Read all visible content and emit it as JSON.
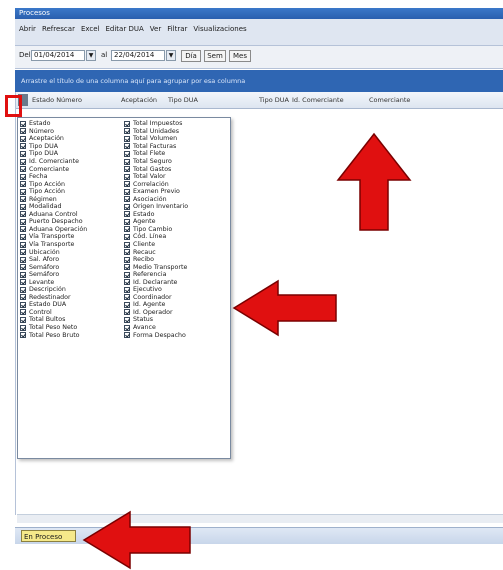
{
  "window": {
    "title": "Procesos"
  },
  "menu": [
    "Abrir",
    "Refrescar",
    "Excel",
    "Editar DUA",
    "Ver",
    "Filtrar",
    "Visualizaciones"
  ],
  "toolbar": {
    "from_label": "Del",
    "from_value": "01/04/2014",
    "to_label": "al",
    "to_value": "22/04/2014",
    "btn_day": "Día",
    "btn_week": "Sem",
    "btn_month": "Mes"
  },
  "group_bar": {
    "text": "Arrastre el título de una columna aquí para agrupar por esa columna"
  },
  "grid_headers": [
    "Estado Número",
    "Aceptación",
    "Tipo DUA",
    "Tipo DUA",
    "Id. Comerciante",
    "Comerciante"
  ],
  "column_chooser": {
    "left": [
      {
        "label": "Estado",
        "checked": true
      },
      {
        "label": "Número",
        "checked": true
      },
      {
        "label": "Aceptación",
        "checked": true
      },
      {
        "label": "Tipo DUA",
        "checked": true
      },
      {
        "label": "Tipo DUA",
        "checked": true
      },
      {
        "label": "Id. Comerciante",
        "checked": true
      },
      {
        "label": "Comerciante",
        "checked": true
      },
      {
        "label": "Fecha",
        "checked": true
      },
      {
        "label": "Tipo Acción",
        "checked": true
      },
      {
        "label": "Tipo Acción",
        "checked": true
      },
      {
        "label": "Régimen",
        "checked": true
      },
      {
        "label": "Modalidad",
        "checked": true
      },
      {
        "label": "Aduana Control",
        "checked": true
      },
      {
        "label": "Puerto Despacho",
        "checked": true
      },
      {
        "label": "Aduana Operación",
        "checked": true
      },
      {
        "label": "Vía Transporte",
        "checked": true
      },
      {
        "label": "Vía Transporte",
        "checked": true
      },
      {
        "label": "Ubicación",
        "checked": true
      },
      {
        "label": "Sal. Aforo",
        "checked": true
      },
      {
        "label": "Semáforo",
        "checked": true
      },
      {
        "label": "Semáforo",
        "checked": true
      },
      {
        "label": "Levante",
        "checked": true
      },
      {
        "label": "Descripción",
        "checked": true
      },
      {
        "label": "Redestinador",
        "checked": true
      },
      {
        "label": "Estado DUA",
        "checked": true
      },
      {
        "label": "Control",
        "checked": true
      },
      {
        "label": "Total Bultos",
        "checked": true
      },
      {
        "label": "Total Peso Neto",
        "checked": true
      },
      {
        "label": "Total Peso Bruto",
        "checked": true
      }
    ],
    "right": [
      {
        "label": "Total Impuestos",
        "checked": true
      },
      {
        "label": "Total Unidades",
        "checked": true
      },
      {
        "label": "Total Volumen",
        "checked": true
      },
      {
        "label": "Total Facturas",
        "checked": true
      },
      {
        "label": "Total Flete",
        "checked": true
      },
      {
        "label": "Total Seguro",
        "checked": true
      },
      {
        "label": "Total Gastos",
        "checked": true
      },
      {
        "label": "Total Valor",
        "checked": true
      },
      {
        "label": "Correlación",
        "checked": true
      },
      {
        "label": "Examen Previo",
        "checked": true
      },
      {
        "label": "Asociación",
        "checked": true
      },
      {
        "label": "Origen Inventario",
        "checked": true
      },
      {
        "label": "Estado",
        "checked": true
      },
      {
        "label": "Agente",
        "checked": true
      },
      {
        "label": "Tipo Cambio",
        "checked": true
      },
      {
        "label": "Cód. Línea",
        "checked": true
      },
      {
        "label": "Cliente",
        "checked": true
      },
      {
        "label": "Recauc",
        "checked": true
      },
      {
        "label": "Recibo",
        "checked": true
      },
      {
        "label": "Medio Transporte",
        "checked": true
      },
      {
        "label": "Referencia",
        "checked": true
      },
      {
        "label": "Id. Declarante",
        "checked": true
      },
      {
        "label": "Ejecutivo",
        "checked": true
      },
      {
        "label": "Coordinador",
        "checked": true
      },
      {
        "label": "Id. Agente",
        "checked": true
      },
      {
        "label": "Id. Operador",
        "checked": true
      },
      {
        "label": "Status",
        "checked": true
      },
      {
        "label": "Avance",
        "checked": true
      },
      {
        "label": "Forma Despacho",
        "checked": true
      }
    ]
  },
  "status_tab": {
    "label": "En Proceso"
  },
  "colors": {
    "annotation_red": "#e01010",
    "group_bar": "#2f66b3",
    "status_tab": "#f5e98a"
  }
}
